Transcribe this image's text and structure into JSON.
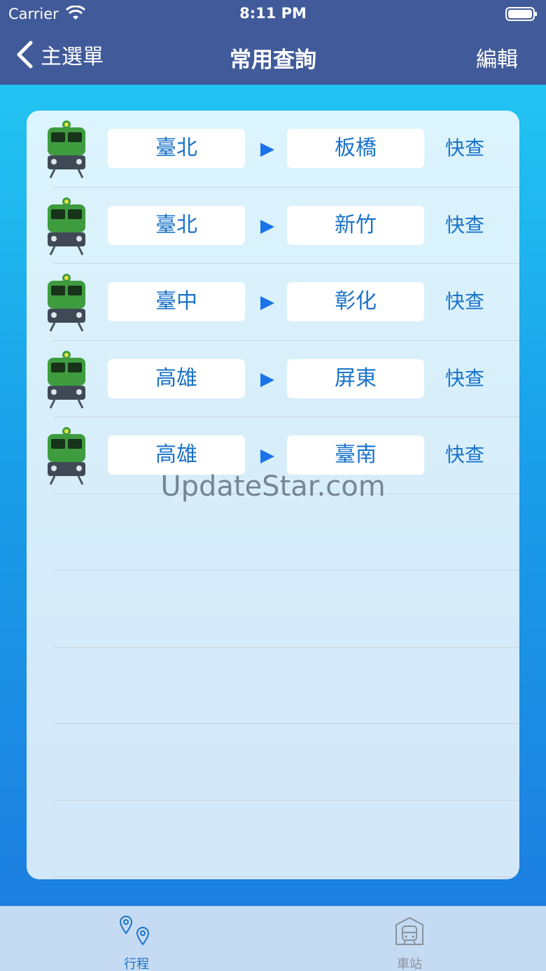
{
  "status_bar": {
    "carrier": "Carrier",
    "time": "8:11 PM"
  },
  "nav": {
    "back_label": "主選單",
    "title": "常用查詢",
    "edit_label": "編輯"
  },
  "routes": [
    {
      "from": "臺北",
      "to": "板橋",
      "action": "快查"
    },
    {
      "from": "臺北",
      "to": "新竹",
      "action": "快查"
    },
    {
      "from": "臺中",
      "to": "彰化",
      "action": "快查"
    },
    {
      "from": "高雄",
      "to": "屏東",
      "action": "快查"
    },
    {
      "from": "高雄",
      "to": "臺南",
      "action": "快查"
    }
  ],
  "watermark": "UpdateStar.com",
  "tabs": [
    {
      "label": "行程",
      "icon": "location-pins-icon",
      "selected": true
    },
    {
      "label": "車站",
      "icon": "station-icon",
      "selected": false
    }
  ],
  "colors": {
    "nav_bar": "#415b9a",
    "accent": "#1a73c9",
    "train_body": "#3e9c3e"
  }
}
